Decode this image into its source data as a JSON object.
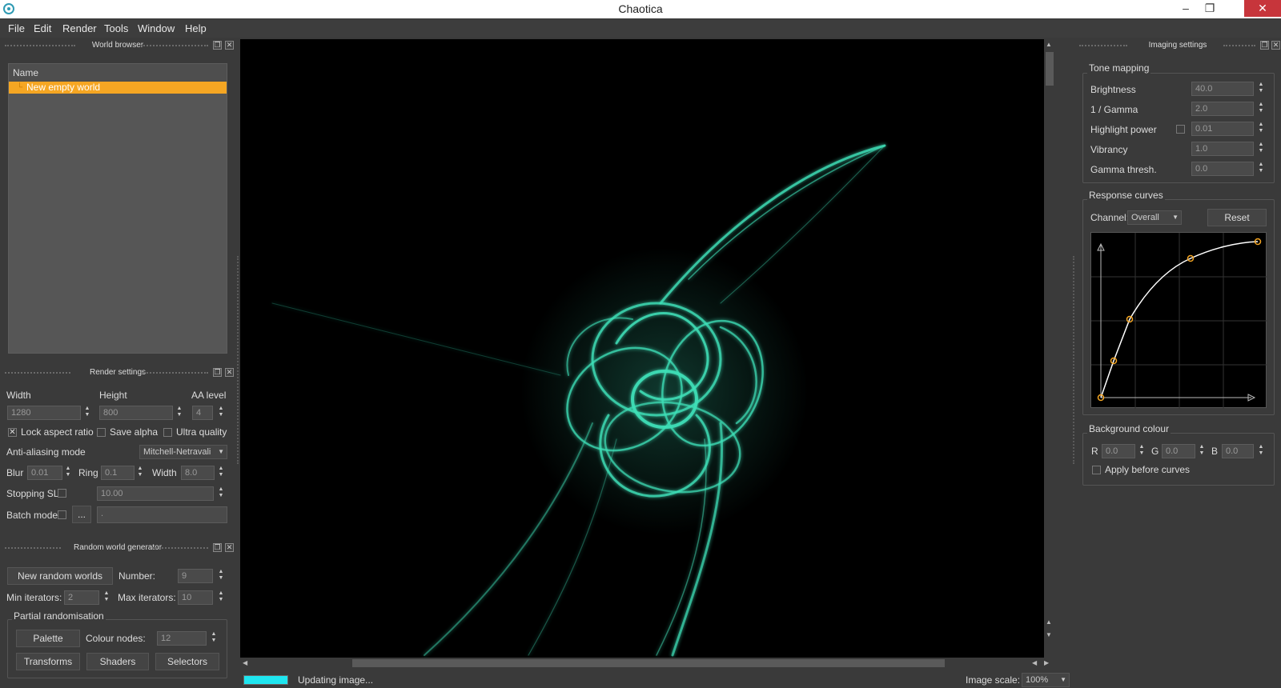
{
  "window": {
    "title": "Chaotica",
    "minimize": "–",
    "restore": "❐",
    "close": "✕"
  },
  "menu": [
    "File",
    "Edit",
    "Render",
    "Tools",
    "Window",
    "Help"
  ],
  "world_browser": {
    "title": "World browser",
    "column": "Name",
    "items": [
      "New empty world"
    ]
  },
  "render_settings": {
    "title": "Render settings",
    "width_label": "Width",
    "height_label": "Height",
    "aa_label": "AA level",
    "width": "1280",
    "height": "800",
    "aa": "4",
    "lock_aspect": "Lock aspect ratio",
    "save_alpha": "Save alpha",
    "ultra_quality": "Ultra quality",
    "aa_mode_label": "Anti-aliasing mode",
    "aa_mode": "Mitchell-Netravali",
    "blur_label": "Blur",
    "blur": "0.01",
    "ring_label": "Ring",
    "ring": "0.1",
    "fwidth_label": "Width",
    "fwidth": "8.0",
    "stopping_label": "Stopping SL",
    "stopping": "10.00",
    "batch_label": "Batch mode",
    "batch_btn": "...",
    "batch_path": "."
  },
  "random_gen": {
    "title": "Random world generator",
    "new_btn": "New random worlds",
    "number_label": "Number:",
    "number": "9",
    "min_label": "Min iterators:",
    "min": "2",
    "max_label": "Max iterators:",
    "max": "10",
    "partial_title": "Partial randomisation",
    "palette_btn": "Palette",
    "colour_nodes_label": "Colour nodes:",
    "colour_nodes": "12",
    "transforms_btn": "Transforms",
    "shaders_btn": "Shaders",
    "selectors_btn": "Selectors"
  },
  "imaging": {
    "title": "Imaging settings",
    "tone_title": "Tone mapping",
    "rows": [
      {
        "label": "Brightness",
        "value": "40.0"
      },
      {
        "label": "1 / Gamma",
        "value": "2.0"
      },
      {
        "label": "Highlight power",
        "value": "0.01"
      },
      {
        "label": "Vibrancy",
        "value": "1.0"
      },
      {
        "label": "Gamma thresh.",
        "value": "0.0"
      }
    ],
    "curves_title": "Response curves",
    "channel_label": "Channel:",
    "channel": "Overall",
    "reset_btn": "Reset",
    "bg_title": "Background colour",
    "r_label": "R",
    "r": "0.0",
    "g_label": "G",
    "g": "0.0",
    "b_label": "B",
    "b": "0.0",
    "apply_before": "Apply before curves"
  },
  "status": {
    "progress": 1.0,
    "text": "Updating image...",
    "scale_label": "Image scale:",
    "scale": "100%"
  },
  "colors": {
    "accent": "#f5a623",
    "flame": "#3fe0b8",
    "progress": "#1fe6f0"
  }
}
